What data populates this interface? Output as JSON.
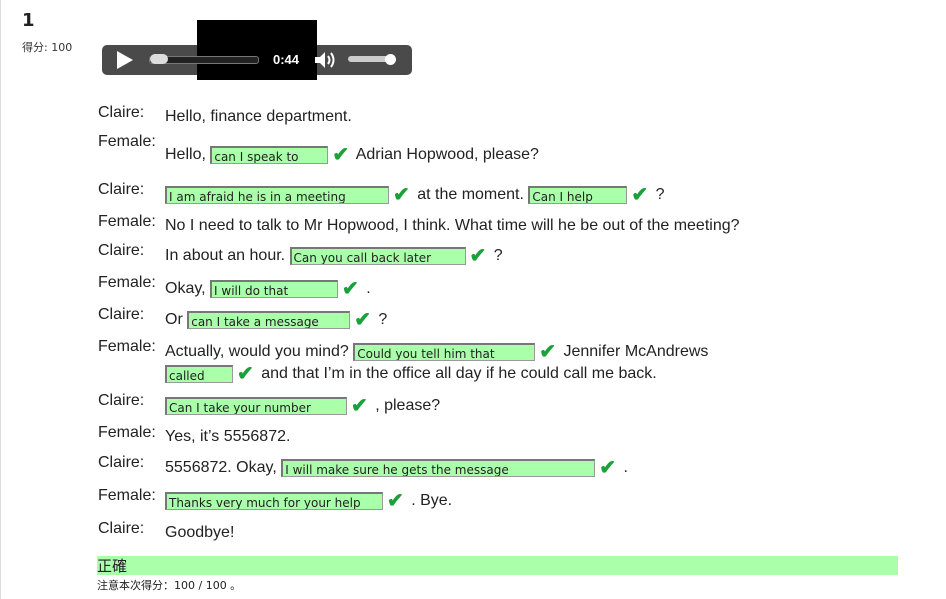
{
  "question": {
    "number": "1",
    "score_label": "得分: 100"
  },
  "player": {
    "time": "0:44"
  },
  "lines": [
    {
      "speaker": "Claire:",
      "parts": [
        {
          "t": "Hello, finance department."
        }
      ]
    },
    {
      "speaker": "Female:",
      "parts": [
        {
          "t": "Hello, "
        },
        {
          "a": "can I speak to",
          "w": 118
        },
        {
          "t": " Adrian Hopwood, please?"
        }
      ]
    },
    {
      "speaker": "Claire:",
      "parts": [
        {
          "a": "I am afraid he is in a meeting",
          "w": 224
        },
        {
          "t": " at the moment. "
        },
        {
          "a": "Can I help",
          "w": 99
        },
        {
          "t": " ?"
        }
      ]
    },
    {
      "speaker": "Female:",
      "parts": [
        {
          "t": "No I need to talk to Mr Hopwood, I think. What time will he be out of the meeting?"
        }
      ]
    },
    {
      "speaker": "Claire:",
      "parts": [
        {
          "t": "In about an hour. "
        },
        {
          "a": "Can you call back later",
          "w": 176
        },
        {
          "t": " ?"
        }
      ]
    },
    {
      "speaker": "Female:",
      "parts": [
        {
          "t": "Okay, "
        },
        {
          "a": "I will do that",
          "w": 128
        },
        {
          "t": " ."
        }
      ]
    },
    {
      "speaker": "Claire:",
      "parts": [
        {
          "t": "Or "
        },
        {
          "a": "can I take a message",
          "w": 163
        },
        {
          "t": " ?"
        }
      ]
    },
    {
      "speaker": "Female:",
      "parts": [
        {
          "t": "Actually, would you mind? "
        },
        {
          "a": "Could you tell him that",
          "w": 182
        },
        {
          "t": " Jennifer McAndrews"
        }
      ],
      "parts2": [
        {
          "a": "called",
          "w": 68
        },
        {
          "t": " and that I’m in the office all day if he could call me back."
        }
      ]
    },
    {
      "speaker": "Claire:",
      "parts": [
        {
          "a": "Can I take your number",
          "w": 182
        },
        {
          "t": " , please?"
        }
      ]
    },
    {
      "speaker": "Female:",
      "parts": [
        {
          "t": "Yes, it’s 5556872."
        }
      ]
    },
    {
      "speaker": "Claire:",
      "parts": [
        {
          "t": "5556872.  Okay, "
        },
        {
          "a": "I will make sure he gets the message",
          "w": 314
        },
        {
          "t": " ."
        }
      ]
    },
    {
      "speaker": "Female:",
      "parts": [
        {
          "a": "Thanks very much for your help",
          "w": 218
        },
        {
          "t": " . Bye."
        }
      ]
    },
    {
      "speaker": "Claire:",
      "parts": [
        {
          "t": "Goodbye!"
        }
      ]
    }
  ],
  "result": {
    "label": "正確",
    "note": "注意本次得分：100 / 100 。"
  },
  "check_icon_glyph": "✔",
  "colors": {
    "correct_fill": "#aaffaa",
    "check_green": "#1aa13a"
  }
}
